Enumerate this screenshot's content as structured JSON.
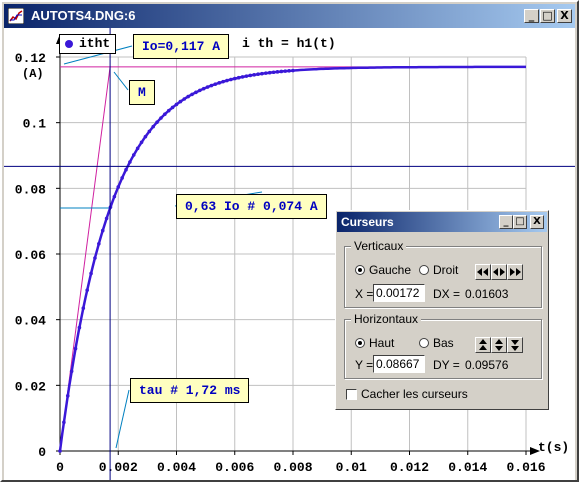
{
  "window": {
    "title": "AUTOTS4.DNG:6",
    "buttons": [
      "_",
      "□",
      "X"
    ]
  },
  "plot": {
    "legend": "itht",
    "formula": "i th = h1(t)",
    "y_unit": "(A)",
    "x_unit": "t(s)"
  },
  "annotations": {
    "io": "Io=0,117 A",
    "m": "M",
    "level": "0,63 Io # 0,074 A",
    "tau": "tau # 1,72 ms"
  },
  "chart_data": {
    "type": "line",
    "x_tick_labels": [
      "0",
      "0.002",
      "0.004",
      "0.006",
      "0.008",
      "0.01",
      "0.012",
      "0.014",
      "0.016"
    ],
    "y_tick_labels": [
      "0",
      "0.02",
      "0.04",
      "0.06",
      "0.08",
      "0.1",
      "0.12"
    ],
    "xlim": [
      0,
      0.016
    ],
    "ylim": [
      0,
      0.12
    ],
    "series": [
      {
        "name": "itht",
        "model": "i = Io*(1-exp(-t/tau))",
        "Io": 0.117,
        "tau": 0.00172,
        "x_range": [
          0,
          0.016
        ],
        "color": "#3a18d8"
      }
    ],
    "tangent_line": {
      "from": [
        0,
        0
      ],
      "to": [
        0.00172,
        0.117
      ],
      "color": "#d020a0"
    },
    "io_level": 0.117,
    "level_063": 0.074,
    "cursor_vertical_x": 0.00172,
    "cursor_horizontal_y": 0.08667,
    "grid": true
  },
  "cursors_dialog": {
    "title": "Curseurs",
    "vertical_group": "Verticaux",
    "left_radio": "Gauche",
    "right_radio": "Droit",
    "x_label": "X =",
    "x_value": "0.00172",
    "dx_label": "DX =",
    "dx_value": "0.01603",
    "horizontal_group": "Horizontaux",
    "top_radio": "Haut",
    "bottom_radio": "Bas",
    "y_label": "Y =",
    "y_value": "0.08667",
    "dy_label": "DY =",
    "dy_value": "0.09576",
    "hide_cursors": "Cacher les curseurs"
  }
}
